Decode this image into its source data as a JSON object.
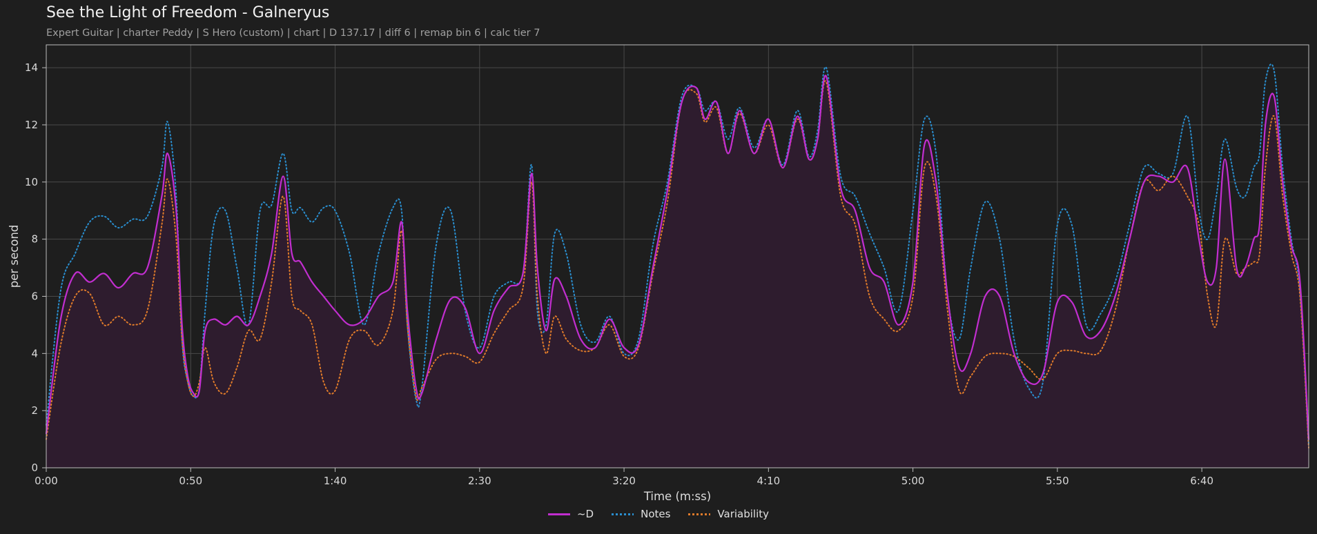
{
  "header": {
    "title": "See the Light of Freedom - Galneryus",
    "subtitle": "Expert Guitar  |  charter Peddy  |  S Hero (custom)  |  chart  |  D 137.17  |  diff 6  |  remap bin 6  |  calc tier 7"
  },
  "chart_data": {
    "type": "line",
    "xlabel": "Time (m:ss)",
    "ylabel": "per second",
    "xlim": [
      0,
      437
    ],
    "ylim": [
      0,
      14.8
    ],
    "x_ticks": [
      {
        "value": 0,
        "label": "0:00"
      },
      {
        "value": 50,
        "label": "0:50"
      },
      {
        "value": 100,
        "label": "1:40"
      },
      {
        "value": 150,
        "label": "2:30"
      },
      {
        "value": 200,
        "label": "3:20"
      },
      {
        "value": 250,
        "label": "4:10"
      },
      {
        "value": 300,
        "label": "5:00"
      },
      {
        "value": 350,
        "label": "5:50"
      },
      {
        "value": 400,
        "label": "6:40"
      }
    ],
    "y_ticks": [
      0,
      2,
      4,
      6,
      8,
      10,
      12,
      14
    ],
    "grid": true,
    "legend_position": "bottom-center",
    "x": [
      0,
      5,
      10,
      15,
      20,
      25,
      30,
      35,
      40,
      42,
      45,
      47,
      49,
      51,
      53,
      55,
      58,
      62,
      66,
      70,
      74,
      78,
      82,
      85,
      88,
      92,
      96,
      100,
      105,
      110,
      115,
      120,
      123,
      125,
      128,
      130,
      135,
      140,
      145,
      150,
      155,
      160,
      165,
      168,
      170,
      173,
      176,
      180,
      185,
      190,
      195,
      200,
      205,
      210,
      215,
      220,
      225,
      228,
      232,
      236,
      240,
      245,
      250,
      255,
      260,
      264,
      267,
      270,
      275,
      280,
      285,
      290,
      295,
      300,
      304,
      308,
      312,
      316,
      320,
      325,
      330,
      335,
      340,
      345,
      350,
      355,
      360,
      365,
      370,
      375,
      380,
      385,
      390,
      395,
      399,
      402,
      405,
      408,
      412,
      415,
      418,
      420,
      422,
      425,
      428,
      431,
      434,
      437
    ],
    "series": [
      {
        "name": "~D",
        "color": "#c22ed0",
        "style": "solid",
        "fill": "#2e1c2e",
        "values": [
          1.2,
          5.2,
          6.8,
          6.5,
          6.8,
          6.3,
          6.8,
          7.0,
          9.5,
          11.0,
          9.0,
          5.0,
          3.2,
          2.6,
          2.7,
          4.8,
          5.2,
          5.0,
          5.3,
          5.0,
          6.0,
          7.5,
          10.2,
          7.5,
          7.2,
          6.5,
          6.0,
          5.5,
          5.0,
          5.2,
          6.0,
          6.5,
          8.6,
          5.5,
          2.8,
          2.6,
          4.5,
          5.9,
          5.6,
          4.0,
          5.5,
          6.3,
          6.8,
          10.3,
          7.0,
          4.8,
          6.6,
          6.0,
          4.5,
          4.2,
          5.2,
          4.2,
          4.3,
          7.0,
          9.7,
          12.8,
          13.3,
          12.2,
          12.8,
          11.0,
          12.5,
          11.0,
          12.2,
          10.5,
          12.3,
          10.8,
          11.5,
          13.7,
          9.8,
          9.0,
          7.0,
          6.5,
          5.0,
          6.5,
          11.3,
          10.0,
          6.0,
          3.5,
          4.0,
          6.0,
          6.0,
          4.0,
          3.0,
          3.3,
          5.8,
          5.8,
          4.6,
          4.8,
          6.0,
          8.0,
          10.0,
          10.2,
          10.0,
          10.5,
          8.0,
          6.5,
          7.0,
          10.8,
          7.0,
          7.0,
          8.0,
          8.5,
          12.0,
          13.0,
          10.0,
          7.8,
          6.5,
          1.0
        ]
      },
      {
        "name": "Notes",
        "color": "#2a8fd0",
        "style": "dotted",
        "values": [
          1.5,
          6.2,
          7.5,
          8.6,
          8.8,
          8.4,
          8.7,
          8.8,
          10.5,
          12.1,
          9.5,
          4.5,
          3.0,
          2.5,
          2.8,
          5.5,
          8.5,
          9.0,
          7.0,
          5.0,
          9.0,
          9.2,
          11.0,
          9.0,
          9.1,
          8.6,
          9.1,
          9.0,
          7.5,
          5.0,
          7.5,
          9.1,
          9.0,
          5.0,
          2.4,
          2.8,
          7.8,
          9.0,
          5.5,
          4.2,
          6.0,
          6.5,
          6.8,
          10.6,
          5.5,
          5.0,
          8.2,
          7.5,
          5.0,
          4.4,
          5.3,
          4.0,
          4.5,
          7.8,
          10.0,
          13.0,
          13.3,
          12.5,
          12.8,
          11.5,
          12.6,
          11.2,
          12.2,
          10.6,
          12.5,
          10.9,
          11.8,
          14.0,
          10.2,
          9.5,
          8.2,
          7.0,
          5.5,
          9.0,
          12.2,
          11.0,
          6.0,
          4.5,
          7.0,
          9.3,
          8.0,
          4.5,
          2.8,
          3.0,
          8.5,
          8.5,
          5.0,
          5.4,
          6.5,
          8.5,
          10.5,
          10.3,
          10.3,
          12.3,
          9.0,
          8.0,
          9.5,
          11.5,
          9.8,
          9.5,
          10.5,
          11.0,
          13.5,
          13.9,
          10.5,
          8.0,
          6.2,
          0.8
        ]
      },
      {
        "name": "Variability",
        "color": "#e07b2a",
        "style": "dotted",
        "values": [
          1.0,
          4.3,
          6.0,
          6.1,
          5.0,
          5.3,
          5.0,
          5.5,
          8.5,
          10.1,
          8.0,
          4.5,
          3.0,
          2.5,
          3.0,
          4.2,
          3.0,
          2.6,
          3.5,
          4.8,
          4.5,
          6.5,
          9.5,
          6.0,
          5.5,
          5.0,
          3.0,
          2.7,
          4.5,
          4.8,
          4.3,
          5.5,
          8.3,
          5.0,
          2.5,
          2.8,
          3.8,
          4.0,
          3.9,
          3.7,
          4.7,
          5.5,
          6.3,
          10.0,
          6.0,
          4.0,
          5.3,
          4.5,
          4.1,
          4.2,
          5.0,
          3.9,
          4.2,
          6.8,
          9.3,
          12.8,
          13.1,
          12.1,
          12.6,
          11.0,
          12.4,
          11.0,
          12.0,
          10.5,
          12.2,
          10.8,
          11.5,
          13.5,
          9.5,
          8.5,
          6.0,
          5.2,
          4.8,
          6.0,
          10.5,
          9.5,
          5.5,
          2.7,
          3.2,
          3.9,
          4.0,
          3.9,
          3.5,
          3.1,
          4.0,
          4.1,
          4.0,
          4.1,
          5.5,
          8.0,
          10.0,
          9.7,
          10.2,
          9.5,
          8.5,
          6.0,
          5.0,
          8.0,
          6.8,
          7.0,
          7.2,
          7.5,
          10.5,
          12.3,
          9.5,
          7.5,
          6.0,
          0.7
        ]
      }
    ]
  }
}
